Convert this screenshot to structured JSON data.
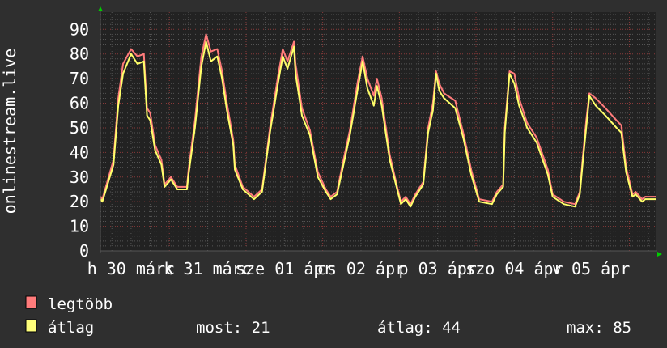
{
  "chart_data": {
    "type": "line",
    "ylabel": "onlinestream.live",
    "ylim": [
      0,
      97
    ],
    "yticks": [
      "0",
      "10",
      "20",
      "30",
      "40",
      "50",
      "60",
      "70",
      "80",
      "90"
    ],
    "xlim": [
      "03-30 02:24",
      "04-06 08:15"
    ],
    "xtick_labels": [
      {
        "label": "h 30 márc",
        "at": "03-30 12:00"
      },
      {
        "label": "k 31 márc",
        "at": "03-31 12:00"
      },
      {
        "label": "sze 01 ápr",
        "at": "04-01 12:00"
      },
      {
        "label": "cs 02 ápr",
        "at": "04-02 12:00"
      },
      {
        "label": "p 03 ápr",
        "at": "04-03 12:00"
      },
      {
        "label": "szo 04 ápr",
        "at": "04-04 12:00"
      },
      {
        "label": "v 05 ápr",
        "at": "04-05 12:00"
      }
    ],
    "grid": true,
    "x": [
      "03-30 02:30",
      "03-30 03:00",
      "03-30 06:30",
      "03-30 08:00",
      "03-30 09:30",
      "03-30 12:00",
      "03-30 14:00",
      "03-30 16:00",
      "03-30 17:00",
      "03-30 18:00",
      "03-30 19:30",
      "03-30 21:30",
      "03-30 22:30",
      "03-31 00:30",
      "03-31 02:30",
      "03-31 05:30",
      "03-31 06:00",
      "03-31 08:00",
      "03-31 10:00",
      "03-31 11:30",
      "03-31 13:00",
      "03-31 15:00",
      "03-31 16:30",
      "03-31 18:00",
      "03-31 20:00",
      "03-31 20:30",
      "03-31 23:00",
      "04-01 02:30",
      "04-01 05:00",
      "04-01 07:30",
      "04-01 10:00",
      "04-01 11:30",
      "04-01 13:00",
      "04-01 15:00",
      "04-01 15:30",
      "04-01 17:30",
      "04-01 20:00",
      "04-01 22:30",
      "04-02 01:00",
      "04-02 02:30",
      "04-02 04:30",
      "04-02 06:30",
      "04-02 08:30",
      "04-02 11:00",
      "04-02 12:30",
      "04-02 14:00",
      "04-02 16:00",
      "04-02 17:00",
      "04-02 18:30",
      "04-02 21:00",
      "04-02 23:30",
      "04-03 00:30",
      "04-03 02:00",
      "04-03 03:30",
      "04-03 05:00",
      "04-03 07:30",
      "04-03 09:00",
      "04-03 10:30",
      "04-03 11:30",
      "04-03 12:30",
      "04-03 14:00",
      "04-03 17:30",
      "04-03 20:00",
      "04-03 22:30",
      "04-04 01:00",
      "04-04 05:00",
      "04-04 06:30",
      "04-04 08:30",
      "04-04 09:00",
      "04-04 10:30",
      "04-04 12:00",
      "04-04 13:30",
      "04-04 16:00",
      "04-04 19:00",
      "04-04 22:30",
      "04-05 00:00",
      "04-05 03:30",
      "04-05 07:00",
      "04-05 08:30",
      "04-05 09:30",
      "04-05 10:30",
      "04-05 11:30",
      "04-05 13:30",
      "04-05 16:30",
      "04-05 20:00",
      "04-05 21:30",
      "04-05 23:00",
      "04-06 01:00",
      "04-06 02:00",
      "04-06 04:00",
      "04-06 05:00",
      "04-06 08:15"
    ],
    "series": [
      {
        "name": "legtöbb",
        "color": "#ff7b7b",
        "values": [
          22,
          21,
          37,
          62,
          76,
          82,
          79,
          80,
          58,
          56,
          43,
          37,
          27,
          30,
          26,
          26,
          33,
          53,
          79,
          88,
          81,
          82,
          73,
          60,
          45,
          35,
          26,
          22,
          25,
          50,
          71,
          82,
          77,
          85,
          76,
          58,
          49,
          32,
          25,
          22,
          24,
          37,
          49,
          69,
          79,
          70,
          63,
          70,
          62,
          39,
          25,
          20,
          22,
          19,
          23,
          28,
          50,
          60,
          73,
          68,
          64,
          61,
          48,
          33,
          21,
          20,
          24,
          27,
          50,
          73,
          72,
          62,
          52,
          46,
          33,
          23,
          20,
          19,
          24,
          39,
          53,
          64,
          62,
          58,
          53,
          51,
          34,
          23,
          24,
          21,
          22,
          22
        ]
      },
      {
        "name": "átlag",
        "color": "#ffff6a",
        "values": [
          21,
          20,
          35,
          59,
          72,
          80,
          76,
          77,
          55,
          53,
          41,
          35,
          26,
          29,
          25,
          25,
          31,
          50,
          75,
          85,
          77,
          79,
          70,
          57,
          43,
          33,
          25,
          21,
          24,
          48,
          68,
          79,
          74,
          83,
          72,
          55,
          47,
          30,
          24,
          21,
          23,
          35,
          47,
          66,
          77,
          66,
          59,
          67,
          59,
          37,
          24,
          19,
          21,
          18,
          22,
          27,
          48,
          57,
          72,
          65,
          62,
          58,
          46,
          31,
          20,
          19,
          23,
          26,
          48,
          72,
          68,
          59,
          50,
          44,
          31,
          22,
          19,
          18,
          23,
          37,
          50,
          63,
          59,
          55,
          50,
          48,
          32,
          22,
          23,
          20,
          21,
          21
        ]
      }
    ]
  },
  "legend": {
    "items": [
      {
        "label": "legtöbb",
        "color": "#ff7b7b"
      },
      {
        "label": "átlag",
        "color": "#ffff7b"
      }
    ],
    "stats": {
      "now": "most: 21",
      "avg": "átlag: 44",
      "max": "max: 85"
    }
  },
  "colors": {
    "background": "#2f2f2f",
    "plot_background": "#222222",
    "major_grid": "#8a3a3a",
    "minor_grid": "#555555",
    "arrow": "#00cc00"
  }
}
